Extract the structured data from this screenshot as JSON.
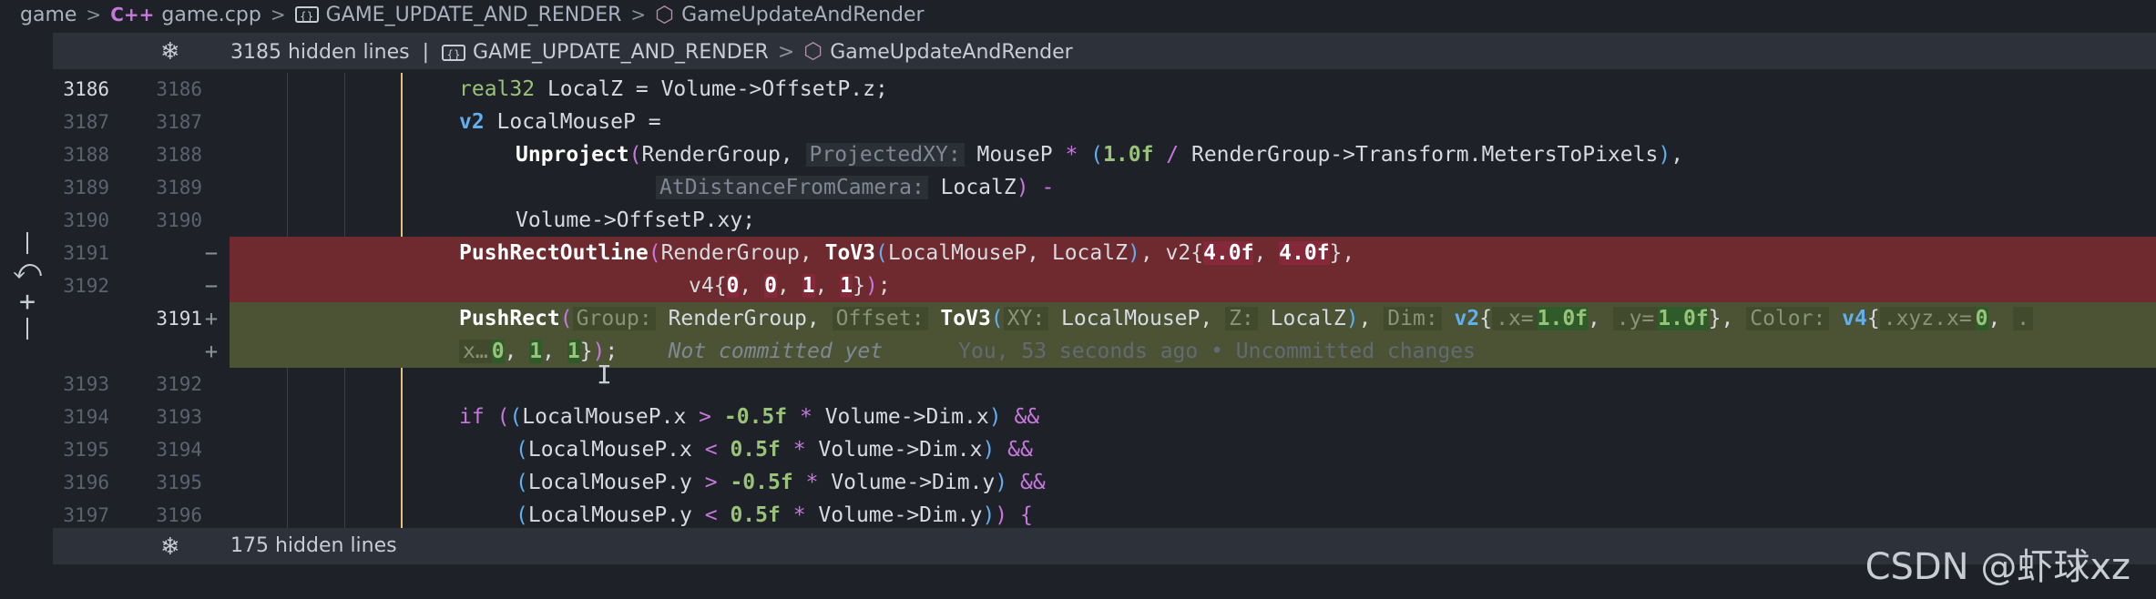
{
  "breadcrumb": {
    "file_root": "game",
    "file_icon": "C++",
    "file": "game.cpp",
    "namespace": "GAME_UPDATE_AND_RENDER",
    "symbol": "GameUpdateAndRender"
  },
  "folds": {
    "top_hidden": "3185 hidden lines",
    "top_ns": "GAME_UPDATE_AND_RENDER",
    "top_symbol": "GameUpdateAndRender",
    "bottom_hidden": "175 hidden lines"
  },
  "lines": [
    {
      "old": "3186",
      "new": "3186"
    },
    {
      "old": "3187",
      "new": "3187"
    },
    {
      "old": "3188",
      "new": "3188"
    },
    {
      "old": "3189",
      "new": "3189"
    },
    {
      "old": "3190",
      "new": "3190"
    },
    {
      "old": "3191",
      "new": ""
    },
    {
      "old": "3192",
      "new": ""
    },
    {
      "old": "",
      "new": "3191"
    },
    {
      "old": "",
      "new": ""
    },
    {
      "old": "3193",
      "new": "3192"
    },
    {
      "old": "3194",
      "new": "3193"
    },
    {
      "old": "3195",
      "new": "3194"
    },
    {
      "old": "3196",
      "new": "3195"
    },
    {
      "old": "3197",
      "new": "3196"
    }
  ],
  "blame": {
    "status": "Not committed yet",
    "detail": "You, 53 seconds ago • Uncommitted changes"
  },
  "watermark": "CSDN @虾球xz"
}
